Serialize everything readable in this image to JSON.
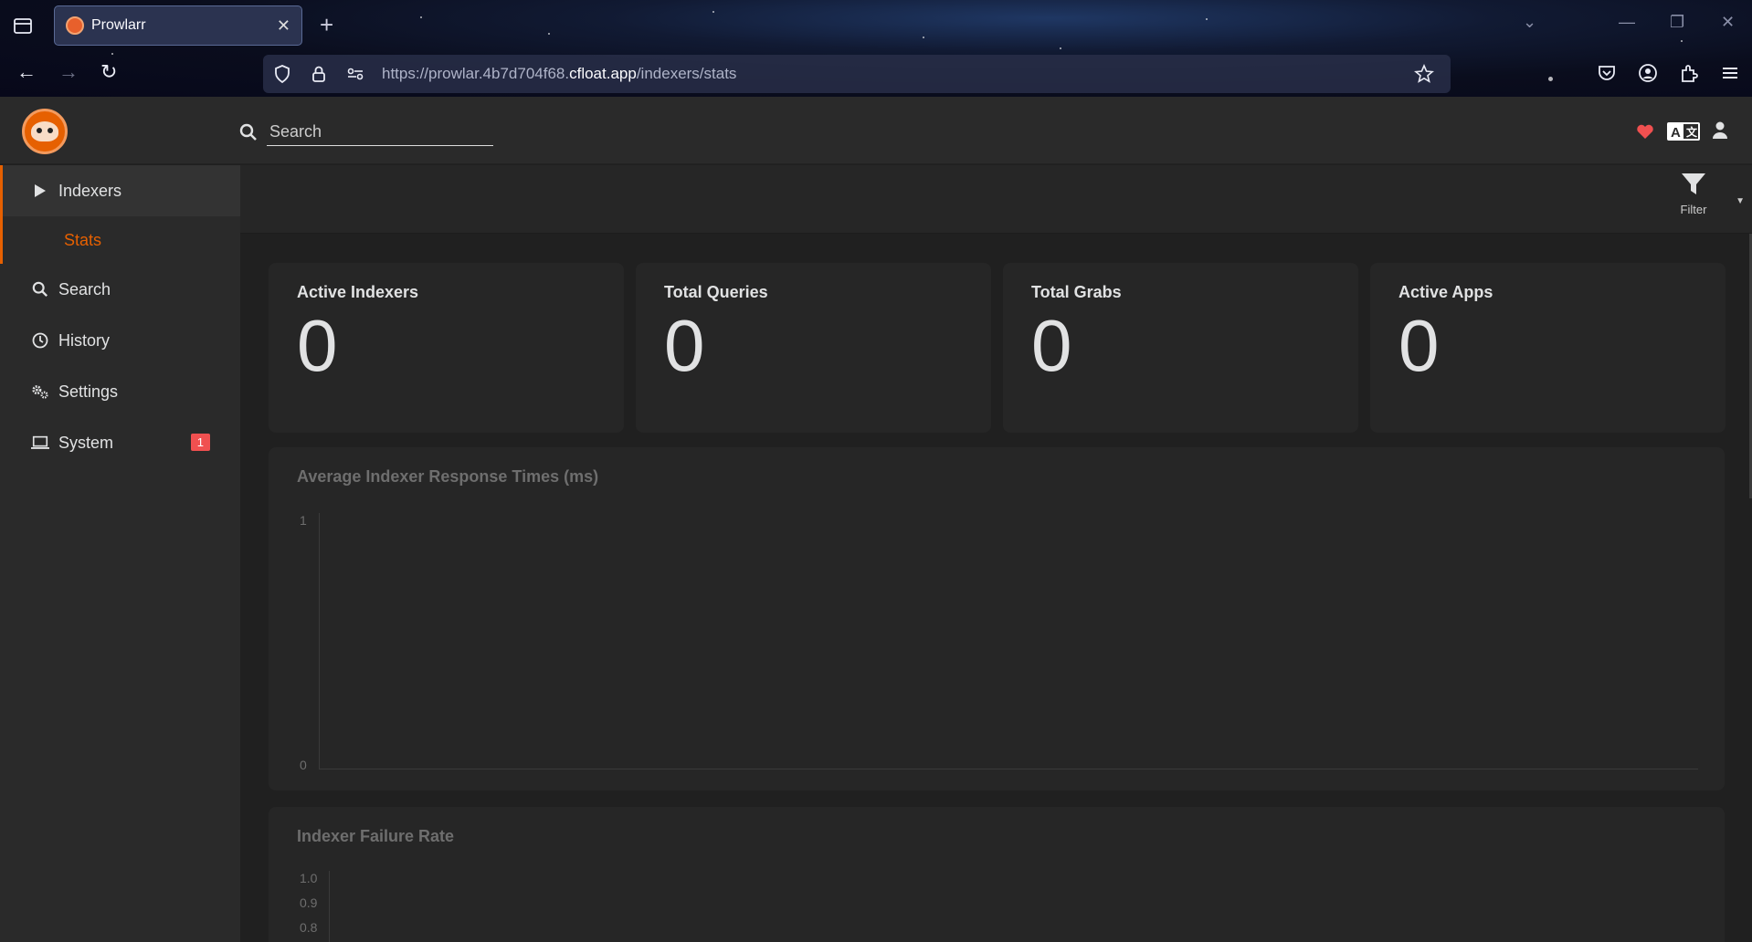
{
  "browser": {
    "tab_title": "Prowlarr",
    "url_prefix": "https://prowlar.4b7d704f68.",
    "url_domain": "cfloat.app",
    "url_path": "/indexers/stats"
  },
  "header": {
    "search_placeholder": "Search"
  },
  "sidebar": {
    "items": [
      {
        "label": "Indexers",
        "icon": "play-icon",
        "active": true
      },
      {
        "label": "Stats",
        "sub": true
      },
      {
        "label": "Search",
        "icon": "search-icon"
      },
      {
        "label": "History",
        "icon": "clock-icon"
      },
      {
        "label": "Settings",
        "icon": "gears-icon"
      },
      {
        "label": "System",
        "icon": "laptop-icon",
        "badge": "1"
      }
    ]
  },
  "toolbar": {
    "filter_label": "Filter"
  },
  "stats": [
    {
      "label": "Active Indexers",
      "value": "0"
    },
    {
      "label": "Total Queries",
      "value": "0"
    },
    {
      "label": "Total Grabs",
      "value": "0"
    },
    {
      "label": "Active Apps",
      "value": "0"
    }
  ],
  "colors": {
    "accent": "#e66001",
    "badge": "#f05050",
    "heart": "#f05050"
  },
  "chart_data": [
    {
      "type": "bar",
      "title": "Average Indexer Response Times (ms)",
      "categories": [],
      "values": [],
      "yticks": [
        "1",
        "0"
      ],
      "ylim": [
        0,
        1
      ]
    },
    {
      "type": "bar",
      "title": "Indexer Failure Rate",
      "categories": [],
      "values": [],
      "yticks": [
        "1.0",
        "0.9",
        "0.8"
      ],
      "ylim": [
        0,
        1
      ]
    }
  ]
}
